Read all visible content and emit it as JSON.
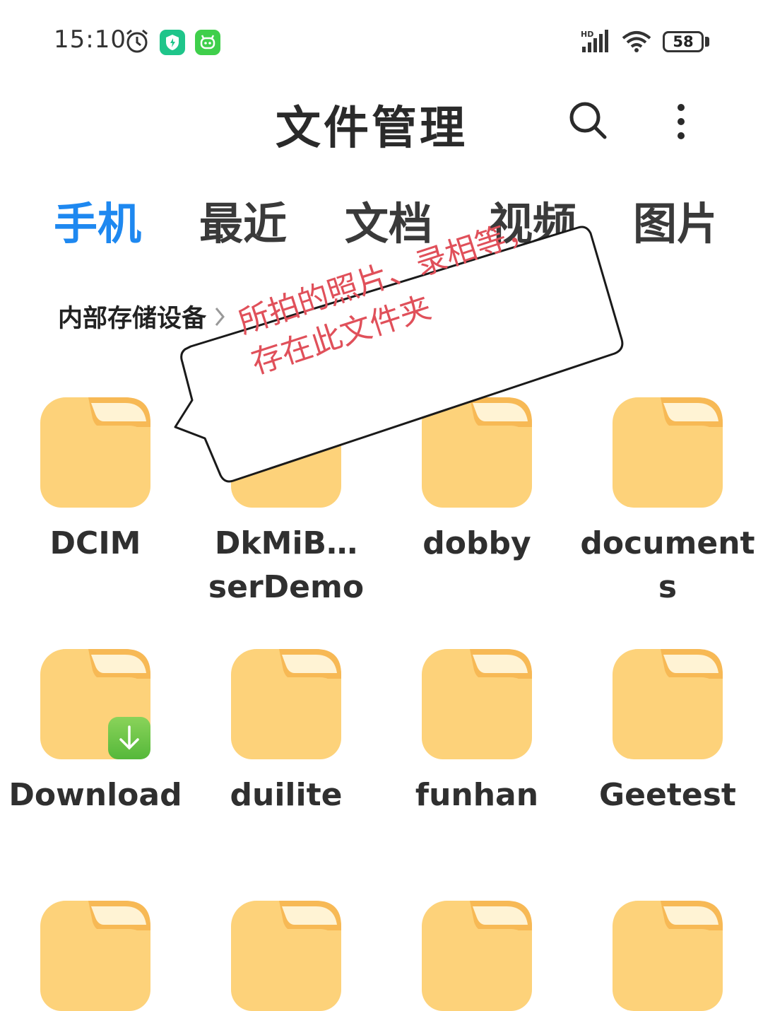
{
  "status_bar": {
    "time": "15:10",
    "battery": "58",
    "icons": [
      "alarm-icon",
      "shield-app-icon",
      "robot-app-icon",
      "hd-signal-icon",
      "wifi-icon",
      "battery-icon"
    ]
  },
  "header": {
    "title": "文件管理",
    "icons": [
      "search-icon",
      "more-vertical-icon"
    ]
  },
  "tabs": [
    {
      "label": "手机",
      "active": true
    },
    {
      "label": "最近",
      "active": false
    },
    {
      "label": "文档",
      "active": false
    },
    {
      "label": "视频",
      "active": false
    },
    {
      "label": "图片",
      "active": false
    }
  ],
  "breadcrumb": {
    "label": "内部存储设备"
  },
  "folders": [
    {
      "name": "DCIM"
    },
    {
      "name": "DkMiB…serDemo"
    },
    {
      "name": "dobby"
    },
    {
      "name": "documents"
    },
    {
      "name": "Download",
      "badge": "download-icon"
    },
    {
      "name": "duilite"
    },
    {
      "name": "funhan"
    },
    {
      "name": "Geetest"
    }
  ],
  "callout": {
    "line1": "所拍的照片、录相等，",
    "line2": "存在此文件夹"
  },
  "colors": {
    "accent": "#1e88f0",
    "folder": "#fdd27a",
    "folder_tab": "#f7b955",
    "annotation": "#e0505a"
  }
}
